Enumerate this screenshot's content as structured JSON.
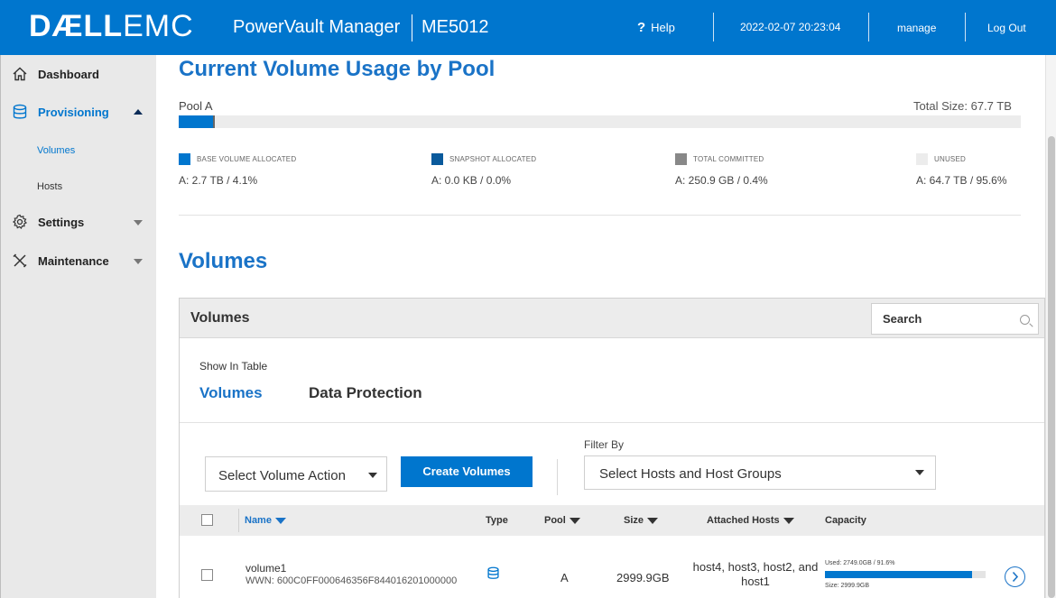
{
  "header": {
    "logo_dell": "DÆLL",
    "logo_emc": "EMC",
    "app_name": "PowerVault Manager",
    "model": "ME5012",
    "help_label": "Help",
    "datetime": "2022-02-07 20:23:04",
    "user": "manage",
    "logout_label": "Log Out",
    "bar_color": "#0076ce"
  },
  "sidebar": {
    "items": [
      {
        "label": "Dashboard",
        "icon": "home-icon"
      },
      {
        "label": "Provisioning",
        "icon": "database-icon",
        "expanded": true
      },
      {
        "label": "Settings",
        "icon": "gear-icon"
      },
      {
        "label": "Maintenance",
        "icon": "tools-icon"
      }
    ],
    "sub_items": [
      {
        "label": "Volumes",
        "active": true
      },
      {
        "label": "Hosts",
        "active": false
      }
    ]
  },
  "usage": {
    "title": "Current Volume Usage by Pool",
    "pool_name": "Pool A",
    "total_size": "Total Size: 67.7 TB",
    "bar_fill_fraction": 0.041,
    "legend": [
      {
        "label": "BASE VOLUME ALLOCATED",
        "value": "A: 2.7 TB / 4.1%",
        "color": "#0076ce"
      },
      {
        "label": "SNAPSHOT ALLOCATED",
        "value": "A: 0.0 KB / 0.0%",
        "color": "#0a5a9c"
      },
      {
        "label": "TOTAL COMMITTED",
        "value": "A: 250.9 GB / 0.4%",
        "color": "#888888"
      },
      {
        "label": "UNUSED",
        "value": "A: 64.7 TB / 95.6%",
        "color": "#ececec"
      }
    ]
  },
  "volumes_section": {
    "title": "Volumes",
    "panel_title": "Volumes",
    "search_placeholder": "Search",
    "show_in_table": "Show In Table",
    "tabs": [
      {
        "label": "Volumes",
        "active": true
      },
      {
        "label": "Data Protection",
        "active": false
      }
    ],
    "select_action": "Select Volume Action",
    "create_button": "Create Volumes",
    "filter_label": "Filter By",
    "filter_select": "Select Hosts and Host Groups",
    "columns": [
      "Name",
      "Type",
      "Pool",
      "Size",
      "Attached Hosts",
      "Capacity"
    ],
    "rows": [
      {
        "name": "volume1",
        "wwn": "WWN: 600C0FF000646356F844016201000000",
        "type_icon": "database-icon",
        "pool": "A",
        "size": "2999.9GB",
        "attached_hosts": "host4, host3, host2, and host1",
        "capacity_used": "Used: 2749.0GB / 91.6%",
        "capacity_fraction": 0.916,
        "capacity_size": "Size: 2999.9GB"
      }
    ]
  }
}
